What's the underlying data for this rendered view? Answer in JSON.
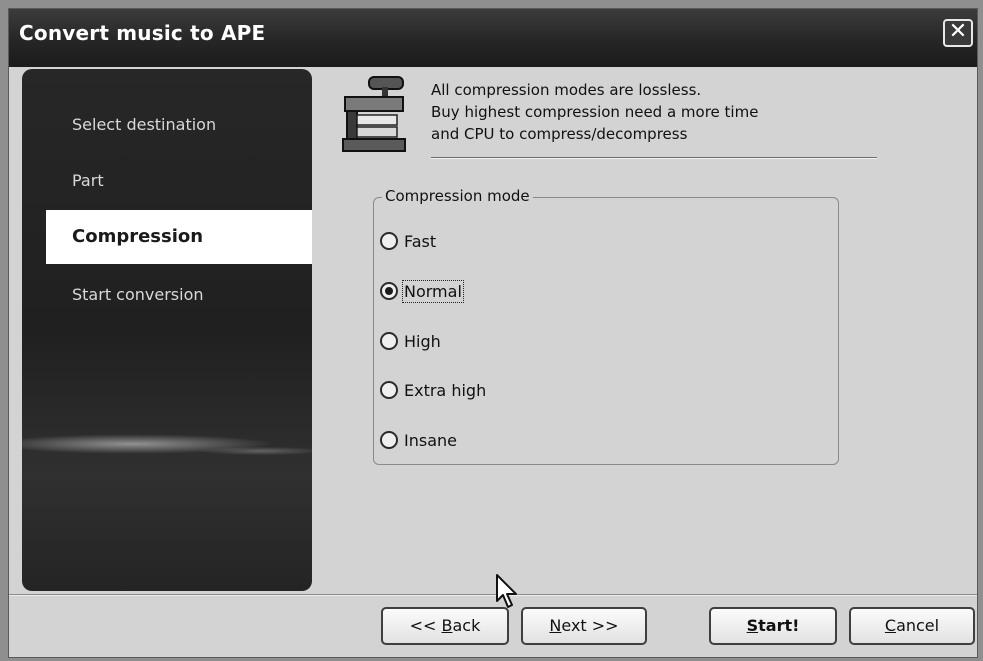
{
  "window": {
    "title": "Convert music to APE",
    "close_glyph": "✕"
  },
  "sidebar": {
    "items": [
      {
        "label": "Select destination",
        "active": false
      },
      {
        "label": "Part",
        "active": false
      },
      {
        "label": "Compression",
        "active": true
      },
      {
        "label": "Start conversion",
        "active": false
      }
    ]
  },
  "header": {
    "icon": "compression-press-icon",
    "lines": [
      "All compression modes are lossless.",
      "Buy highest compression need a more time",
      "and CPU to compress/decompress"
    ]
  },
  "compression": {
    "group_label": "Compression mode",
    "options": [
      {
        "label": "Fast",
        "checked": false
      },
      {
        "label": "Normal",
        "checked": true
      },
      {
        "label": "High",
        "checked": false
      },
      {
        "label": "Extra high",
        "checked": false
      },
      {
        "label": "Insane",
        "checked": false
      }
    ]
  },
  "buttons": {
    "back": {
      "before": "<< ",
      "accel": "B",
      "after": "ack"
    },
    "next": {
      "before": "",
      "accel": "N",
      "after": "ext >>"
    },
    "start": {
      "before": "",
      "accel": "S",
      "after": "tart!"
    },
    "cancel": {
      "before": "",
      "accel": "C",
      "after": "ancel"
    }
  },
  "cursor": {
    "icon": "mouse-pointer-icon"
  }
}
